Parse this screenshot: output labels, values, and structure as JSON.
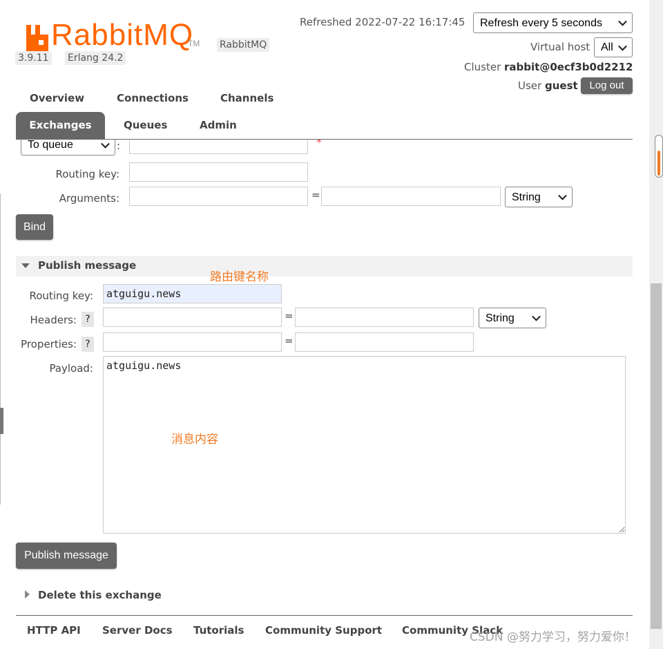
{
  "header": {
    "brand_name": "RabbitMQ",
    "trademark": "TM",
    "product_badge": "RabbitMQ",
    "version": "3.9.11",
    "erlang": "Erlang 24.2",
    "refreshed_text": "Refreshed 2022-07-22 16:17:45",
    "refresh_select": "Refresh every 5 seconds",
    "vhost_label": "Virtual host",
    "vhost_select": "All",
    "cluster_label": "Cluster",
    "cluster_name": "rabbit@0ecf3b0d2212",
    "user_label": "User",
    "user_name": "guest",
    "logout_label": "Log out",
    "brand_color": "#f60"
  },
  "tabs": [
    {
      "label": "Overview",
      "active": false
    },
    {
      "label": "Connections",
      "active": false
    },
    {
      "label": "Channels",
      "active": false
    },
    {
      "label": "Exchanges",
      "active": true
    },
    {
      "label": "Queues",
      "active": false
    },
    {
      "label": "Admin",
      "active": false
    }
  ],
  "bind_form": {
    "destination_type": "To queue",
    "required_mark": "*",
    "routing_key_label": "Routing key:",
    "arguments_label": "Arguments:",
    "argument_type": "String",
    "bind_button": "Bind",
    "colon": ":",
    "equals": "="
  },
  "publish": {
    "section_title": "Publish message",
    "routing_key_label": "Routing key:",
    "routing_key_value": "atguigu.news",
    "headers_label": "Headers:",
    "properties_label": "Properties:",
    "help": "?",
    "header_type": "String",
    "payload_label": "Payload:",
    "payload_value": "atguigu.news",
    "publish_button": "Publish message"
  },
  "annotations": {
    "routing_key_note": "路由键名称",
    "payload_note": "消息内容",
    "color": "#f07b24"
  },
  "delete_section": {
    "title": "Delete this exchange"
  },
  "footer": {
    "links": [
      "HTTP API",
      "Server Docs",
      "Tutorials",
      "Community Support",
      "Community Slack"
    ]
  },
  "watermark": "CSDN @努力学习，努力爱你！"
}
